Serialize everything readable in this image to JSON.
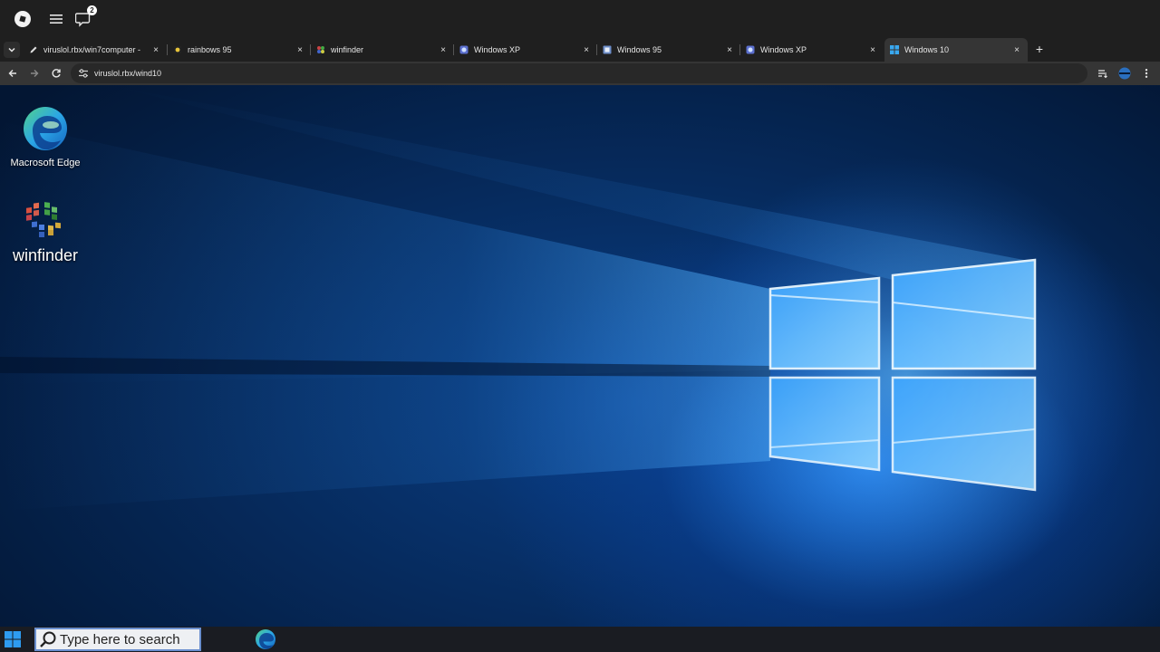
{
  "topbar": {
    "notification_count": "2"
  },
  "tabs": [
    {
      "title": "viruslol.rbx/win7computer -",
      "favicon": "pencil-icon",
      "active": false
    },
    {
      "title": "rainbows 95",
      "favicon": "rainbows-favicon",
      "active": false
    },
    {
      "title": "winfinder",
      "favicon": "winfinder-favicon",
      "active": false
    },
    {
      "title": "Windows XP",
      "favicon": "globe-favicon",
      "active": false
    },
    {
      "title": "Windows 95",
      "favicon": "win95-favicon",
      "active": false
    },
    {
      "title": "Windows XP",
      "favicon": "globe-favicon",
      "active": false
    },
    {
      "title": "Windows 10",
      "favicon": "windows-logo-favicon",
      "active": true
    }
  ],
  "tab_close_glyph": "×",
  "new_tab_glyph": "+",
  "address": {
    "url": "viruslol.rbx/wind10"
  },
  "desktop": {
    "icons": [
      {
        "label": "Macrosoft Edge",
        "icon": "edge-icon"
      },
      {
        "label": "winfinder",
        "icon": "winfinder-icon"
      }
    ]
  },
  "taskbar": {
    "search_placeholder": "Type here to search",
    "pinned": [
      "edge-icon"
    ]
  },
  "colors": {
    "chrome_bg": "#1f1f1f",
    "toolbar_bg": "#353535",
    "desktop_blue": "#0a3f86",
    "glow_blue": "#49b6ff",
    "taskbar_bg": "#1a1c22"
  }
}
